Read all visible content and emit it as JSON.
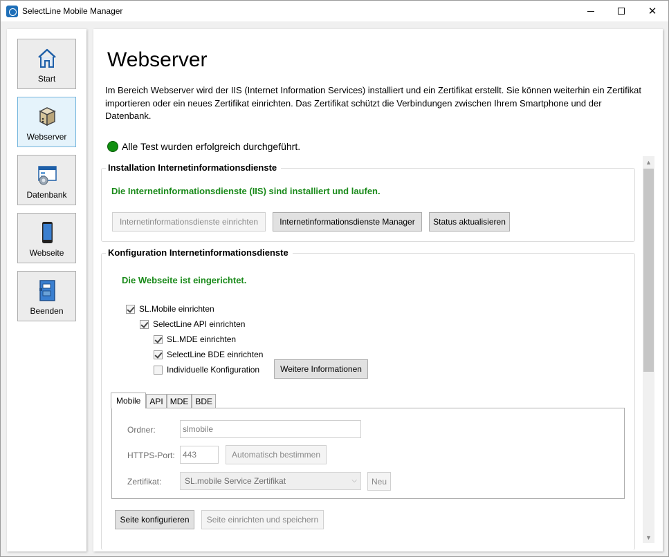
{
  "window": {
    "title": "SelectLine Mobile Manager",
    "controls": {
      "minimize": "",
      "maximize": "",
      "close": "✕"
    }
  },
  "sidebar": {
    "items": [
      {
        "label": "Start",
        "icon": "home-icon",
        "active": false
      },
      {
        "label": "Webserver",
        "icon": "server-box-icon",
        "active": true
      },
      {
        "label": "Datenbank",
        "icon": "database-window-icon",
        "active": false
      },
      {
        "label": "Webseite",
        "icon": "smartphone-icon",
        "active": false
      },
      {
        "label": "Beenden",
        "icon": "exit-door-icon",
        "active": false
      }
    ]
  },
  "main": {
    "title": "Webserver",
    "intro": "Im Bereich Webserver wird der IIS (Internet Information Services) installiert und ein Zertifikat erstellt. Sie können weiterhin ein Zertifikat importieren oder ein neues Zertifikat einrichten. Das Zertifikat schützt die Verbindungen zwischen Ihrem Smartphone und der Datenbank.",
    "status_text": "Alle Test wurden erfolgreich durchgeführt.",
    "status_color": "#108f10"
  },
  "installation": {
    "title": "Installation Internetinformationsdienste",
    "message": "Die Internetinformationsdienste (IIS) sind installiert und laufen.",
    "btn_setup": "Internetinformationsdienste einrichten",
    "btn_manager": "Internetinformationsdienste Manager",
    "btn_refresh": "Status aktualisieren"
  },
  "configuration": {
    "title": "Konfiguration Internetinformationsdienste",
    "message": "Die Webseite ist eingerichtet.",
    "checkboxes": [
      {
        "label": "SL.Mobile einrichten",
        "checked": true
      },
      {
        "label": "SelectLine API einrichten",
        "checked": true
      },
      {
        "label": "SL.MDE einrichten",
        "checked": true
      },
      {
        "label": "SelectLine BDE einrichten",
        "checked": true
      },
      {
        "label": "Individuelle Konfiguration",
        "checked": false
      }
    ],
    "btn_more_info": "Weitere Informationen",
    "tabs": [
      "Mobile",
      "API",
      "MDE",
      "BDE"
    ],
    "active_tab": "Mobile",
    "form": {
      "folder_label": "Ordner:",
      "folder_value": "slmobile",
      "port_label": "HTTPS-Port:",
      "port_value": "443",
      "btn_auto": "Automatisch bestimmen",
      "cert_label": "Zertifikat:",
      "cert_value": "SL.mobile Service Zertifikat",
      "btn_new": "Neu"
    },
    "btn_configure": "Seite konfigurieren",
    "btn_setup_save": "Seite einrichten und speichern"
  },
  "colors": {
    "success_green": "#1a8a1a",
    "active_nav_bg": "#e5f3fb"
  }
}
